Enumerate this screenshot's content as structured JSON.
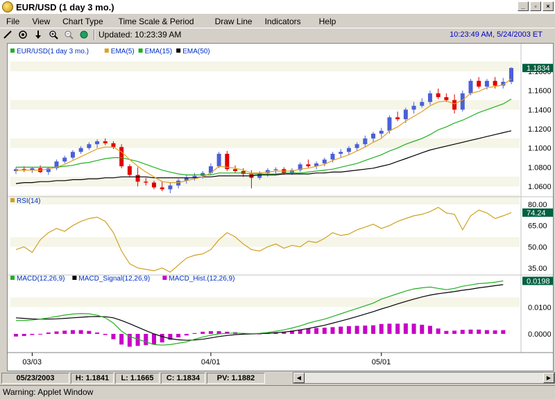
{
  "window": {
    "title": "EUR/USD (1 day  3 mo.)",
    "min_label": "_",
    "max_label": "▫",
    "close_label": "×"
  },
  "menu": [
    "File",
    "View",
    "Chart Type",
    "Time Scale & Period",
    "Draw Line",
    "Indicators",
    "Help"
  ],
  "toolbar": {
    "tools": [
      "draw-line-icon",
      "crosshair-icon",
      "arrow-down-icon",
      "zoom-in-icon",
      "zoom-out-icon",
      "globe-icon"
    ],
    "updated_text": "Updated: 10:23:39 AM",
    "datetime_text": "10:23:49 AM, 5/24/2003 ET"
  },
  "colors": {
    "up_candle": "#4a60d8",
    "down_candle": "#e00000",
    "ema5": "#e0a020",
    "ema15": "#20b020",
    "ema50": "#000000",
    "rsi": "#d0a020",
    "macd": "#20b020",
    "signal": "#000000",
    "hist": "#c800c8",
    "price_badge": "#006040",
    "band": "#f5f5e8"
  },
  "legend_price": [
    {
      "label": "EUR/USD(1 day  3 mo.)",
      "color": "#20b020"
    },
    {
      "label": "EMA(5)",
      "color": "#e0a020"
    },
    {
      "label": "EMA(15)",
      "color": "#20b020"
    },
    {
      "label": "EMA(50)",
      "color": "#000000"
    }
  ],
  "legend_rsi": [
    {
      "label": "RSI(14)",
      "color": "#d0a020"
    }
  ],
  "legend_macd": [
    {
      "label": "MACD(12,26,9)",
      "color": "#20b020"
    },
    {
      "label": "MACD_Signal(12,26,9)",
      "color": "#000000"
    },
    {
      "label": "MACD_Hist.(12,26,9)",
      "color": "#c800c8"
    }
  ],
  "chart_data": {
    "type": "candlestick",
    "dates_labels": [
      "03/03",
      "04/01",
      "05/01"
    ],
    "price_axis": {
      "ticks": [
        "1.1800",
        "1.1600",
        "1.1400",
        "1.1200",
        "1.1000",
        "1.0800",
        "1.0600"
      ],
      "ylim": [
        1.05,
        1.19
      ],
      "current": "1.1834"
    },
    "rsi_axis": {
      "ticks": [
        "80.00",
        "65.00",
        "50.00",
        "35.00"
      ],
      "ylim": [
        30,
        85
      ],
      "current": "74.24"
    },
    "macd_axis": {
      "ticks": [
        "0.0100",
        "0.0000"
      ],
      "ylim": [
        -0.007,
        0.022
      ],
      "current": "0.0198"
    },
    "candles": [
      [
        1.076,
        1.08,
        1.073,
        1.078
      ],
      [
        1.078,
        1.081,
        1.075,
        1.077
      ],
      [
        1.077,
        1.08,
        1.074,
        1.079
      ],
      [
        1.079,
        1.082,
        1.074,
        1.075
      ],
      [
        1.075,
        1.08,
        1.072,
        1.079
      ],
      [
        1.079,
        1.088,
        1.077,
        1.086
      ],
      [
        1.086,
        1.092,
        1.084,
        1.09
      ],
      [
        1.09,
        1.098,
        1.088,
        1.096
      ],
      [
        1.096,
        1.102,
        1.094,
        1.1
      ],
      [
        1.1,
        1.106,
        1.098,
        1.104
      ],
      [
        1.104,
        1.109,
        1.1,
        1.107
      ],
      [
        1.107,
        1.11,
        1.103,
        1.105
      ],
      [
        1.105,
        1.107,
        1.099,
        1.101
      ],
      [
        1.101,
        1.104,
        1.079,
        1.081
      ],
      [
        1.081,
        1.083,
        1.07,
        1.072
      ],
      [
        1.072,
        1.08,
        1.06,
        1.065
      ],
      [
        1.065,
        1.069,
        1.061,
        1.064
      ],
      [
        1.064,
        1.066,
        1.057,
        1.059
      ],
      [
        1.059,
        1.065,
        1.055,
        1.057
      ],
      [
        1.057,
        1.064,
        1.053,
        1.061
      ],
      [
        1.061,
        1.068,
        1.058,
        1.066
      ],
      [
        1.066,
        1.072,
        1.063,
        1.069
      ],
      [
        1.069,
        1.074,
        1.066,
        1.071
      ],
      [
        1.071,
        1.076,
        1.068,
        1.074
      ],
      [
        1.074,
        1.084,
        1.072,
        1.081
      ],
      [
        1.081,
        1.096,
        1.079,
        1.094
      ],
      [
        1.094,
        1.097,
        1.076,
        1.078
      ],
      [
        1.078,
        1.082,
        1.074,
        1.076
      ],
      [
        1.076,
        1.079,
        1.07,
        1.073
      ],
      [
        1.073,
        1.077,
        1.058,
        1.069
      ],
      [
        1.069,
        1.076,
        1.067,
        1.074
      ],
      [
        1.074,
        1.079,
        1.07,
        1.077
      ],
      [
        1.077,
        1.08,
        1.073,
        1.078
      ],
      [
        1.078,
        1.08,
        1.072,
        1.074
      ],
      [
        1.074,
        1.079,
        1.072,
        1.077
      ],
      [
        1.077,
        1.085,
        1.075,
        1.083
      ],
      [
        1.083,
        1.088,
        1.079,
        1.081
      ],
      [
        1.081,
        1.086,
        1.078,
        1.084
      ],
      [
        1.084,
        1.09,
        1.081,
        1.088
      ],
      [
        1.088,
        1.096,
        1.085,
        1.094
      ],
      [
        1.094,
        1.099,
        1.09,
        1.096
      ],
      [
        1.096,
        1.102,
        1.093,
        1.1
      ],
      [
        1.1,
        1.106,
        1.097,
        1.104
      ],
      [
        1.104,
        1.113,
        1.101,
        1.11
      ],
      [
        1.11,
        1.117,
        1.106,
        1.115
      ],
      [
        1.115,
        1.121,
        1.111,
        1.118
      ],
      [
        1.118,
        1.134,
        1.115,
        1.132
      ],
      [
        1.132,
        1.138,
        1.128,
        1.13
      ],
      [
        1.13,
        1.142,
        1.126,
        1.14
      ],
      [
        1.14,
        1.148,
        1.136,
        1.144
      ],
      [
        1.144,
        1.152,
        1.142,
        1.148
      ],
      [
        1.148,
        1.16,
        1.145,
        1.157
      ],
      [
        1.157,
        1.162,
        1.151,
        1.153
      ],
      [
        1.153,
        1.157,
        1.148,
        1.15
      ],
      [
        1.15,
        1.156,
        1.136,
        1.14
      ],
      [
        1.14,
        1.16,
        1.138,
        1.157
      ],
      [
        1.157,
        1.172,
        1.155,
        1.17
      ],
      [
        1.17,
        1.174,
        1.162,
        1.164
      ],
      [
        1.164,
        1.172,
        1.161,
        1.17
      ],
      [
        1.17,
        1.174,
        1.162,
        1.165
      ],
      [
        1.165,
        1.173,
        1.162,
        1.169
      ],
      [
        1.169,
        1.1841,
        1.1665,
        1.1834
      ]
    ],
    "ema5": [
      1.077,
      1.077,
      1.077,
      1.077,
      1.078,
      1.08,
      1.083,
      1.087,
      1.091,
      1.095,
      1.099,
      1.101,
      1.101,
      1.096,
      1.088,
      1.081,
      1.075,
      1.07,
      1.065,
      1.064,
      1.064,
      1.066,
      1.068,
      1.07,
      1.074,
      1.081,
      1.08,
      1.079,
      1.077,
      1.074,
      1.074,
      1.075,
      1.076,
      1.076,
      1.076,
      1.078,
      1.079,
      1.081,
      1.083,
      1.087,
      1.09,
      1.093,
      1.097,
      1.101,
      1.106,
      1.11,
      1.118,
      1.122,
      1.128,
      1.133,
      1.138,
      1.144,
      1.148,
      1.149,
      1.146,
      1.15,
      1.157,
      1.159,
      1.163,
      1.164,
      1.166,
      1.172
    ],
    "ema15": [
      1.08,
      1.08,
      1.08,
      1.08,
      1.08,
      1.08,
      1.081,
      1.082,
      1.084,
      1.085,
      1.087,
      1.089,
      1.09,
      1.09,
      1.088,
      1.086,
      1.083,
      1.08,
      1.077,
      1.075,
      1.073,
      1.072,
      1.072,
      1.072,
      1.072,
      1.074,
      1.074,
      1.074,
      1.074,
      1.073,
      1.073,
      1.073,
      1.073,
      1.074,
      1.074,
      1.074,
      1.075,
      1.076,
      1.077,
      1.078,
      1.08,
      1.082,
      1.084,
      1.087,
      1.09,
      1.093,
      1.097,
      1.1,
      1.104,
      1.107,
      1.11,
      1.114,
      1.119,
      1.122,
      1.126,
      1.129,
      1.133,
      1.137,
      1.14,
      1.143,
      1.146,
      1.151
    ],
    "ema50": [
      1.063,
      1.064,
      1.064,
      1.065,
      1.065,
      1.066,
      1.066,
      1.067,
      1.067,
      1.068,
      1.068,
      1.069,
      1.069,
      1.07,
      1.07,
      1.07,
      1.07,
      1.069,
      1.069,
      1.069,
      1.069,
      1.069,
      1.069,
      1.07,
      1.07,
      1.071,
      1.071,
      1.071,
      1.071,
      1.071,
      1.072,
      1.072,
      1.072,
      1.073,
      1.073,
      1.073,
      1.073,
      1.074,
      1.074,
      1.075,
      1.075,
      1.076,
      1.077,
      1.078,
      1.079,
      1.081,
      1.083,
      1.086,
      1.089,
      1.092,
      1.095,
      1.098,
      1.1,
      1.102,
      1.104,
      1.106,
      1.108,
      1.11,
      1.112,
      1.114,
      1.116,
      1.118
    ],
    "rsi": [
      48,
      50,
      46,
      55,
      60,
      63,
      61,
      65,
      68,
      70,
      71,
      68,
      60,
      47,
      38,
      35,
      34,
      33,
      35,
      32,
      37,
      42,
      44,
      45,
      48,
      55,
      60,
      57,
      52,
      48,
      47,
      50,
      52,
      49,
      51,
      50,
      54,
      53,
      56,
      60,
      58,
      59,
      62,
      64,
      66,
      63,
      65,
      68,
      70,
      72,
      73,
      75,
      78,
      74,
      73,
      62,
      72,
      76,
      74,
      70,
      72,
      74.24
    ],
    "macd": [
      0.005,
      0.005,
      0.0052,
      0.0055,
      0.006,
      0.0065,
      0.007,
      0.0074,
      0.0076,
      0.0075,
      0.007,
      0.006,
      0.004,
      0.001,
      -0.001,
      -0.002,
      -0.003,
      -0.004,
      -0.0042,
      -0.004,
      -0.0035,
      -0.003,
      -0.002,
      -0.0012,
      -0.0005,
      0.0,
      0.0002,
      0.0003,
      0.0002,
      0.0001,
      0.0002,
      0.0005,
      0.001,
      0.0015,
      0.0022,
      0.003,
      0.004,
      0.0048,
      0.0055,
      0.0065,
      0.0075,
      0.0085,
      0.0095,
      0.0105,
      0.0115,
      0.013,
      0.014,
      0.015,
      0.016,
      0.0168,
      0.0172,
      0.0175,
      0.017,
      0.0165,
      0.017,
      0.0178,
      0.0183,
      0.0188,
      0.019,
      0.0193,
      0.0198
    ],
    "signal": [
      0.006,
      0.0058,
      0.0056,
      0.0055,
      0.0055,
      0.0056,
      0.0058,
      0.006,
      0.0062,
      0.0064,
      0.0065,
      0.0064,
      0.006,
      0.005,
      0.0038,
      0.0025,
      0.0012,
      0.0,
      -0.001,
      -0.0018,
      -0.0022,
      -0.0024,
      -0.0023,
      -0.002,
      -0.0015,
      -0.001,
      -0.0006,
      -0.0003,
      -0.0001,
      0.0,
      0.0001,
      0.0002,
      0.0004,
      0.0007,
      0.001,
      0.0015,
      0.002,
      0.0026,
      0.0032,
      0.004,
      0.0048,
      0.0056,
      0.0065,
      0.0074,
      0.0083,
      0.0093,
      0.0102,
      0.0112,
      0.0121,
      0.013,
      0.0138,
      0.0145,
      0.015,
      0.0154,
      0.0158,
      0.0163,
      0.0167,
      0.0172,
      0.0176,
      0.018,
      0.0184
    ],
    "hist": [
      -0.001,
      -0.0008,
      -0.0004,
      0.0,
      0.0005,
      0.0009,
      0.0012,
      0.0014,
      0.0014,
      0.0011,
      0.0005,
      -0.0004,
      -0.002,
      -0.004,
      -0.0048,
      -0.0045,
      -0.0042,
      -0.004,
      -0.0032,
      -0.0022,
      -0.0013,
      -0.0006,
      0.0003,
      0.0008,
      0.001,
      0.001,
      0.0008,
      0.0006,
      0.0003,
      0.0001,
      0.0001,
      0.0003,
      0.0006,
      0.0008,
      0.0012,
      0.0015,
      0.002,
      0.0022,
      0.0023,
      0.0025,
      0.0027,
      0.0029,
      0.003,
      0.0031,
      0.0032,
      0.0037,
      0.0038,
      0.0038,
      0.0039,
      0.0038,
      0.0034,
      0.003,
      0.002,
      0.0011,
      0.0012,
      0.0015,
      0.0016,
      0.0016,
      0.0014,
      0.0013,
      0.0014
    ]
  },
  "status": {
    "date": "05/23/2003",
    "high": "H: 1.1841",
    "low": "L: 1.1665",
    "close": "C: 1.1834",
    "pv": "PV: 1.1882"
  },
  "warning_text": "Warning: Applet Window"
}
